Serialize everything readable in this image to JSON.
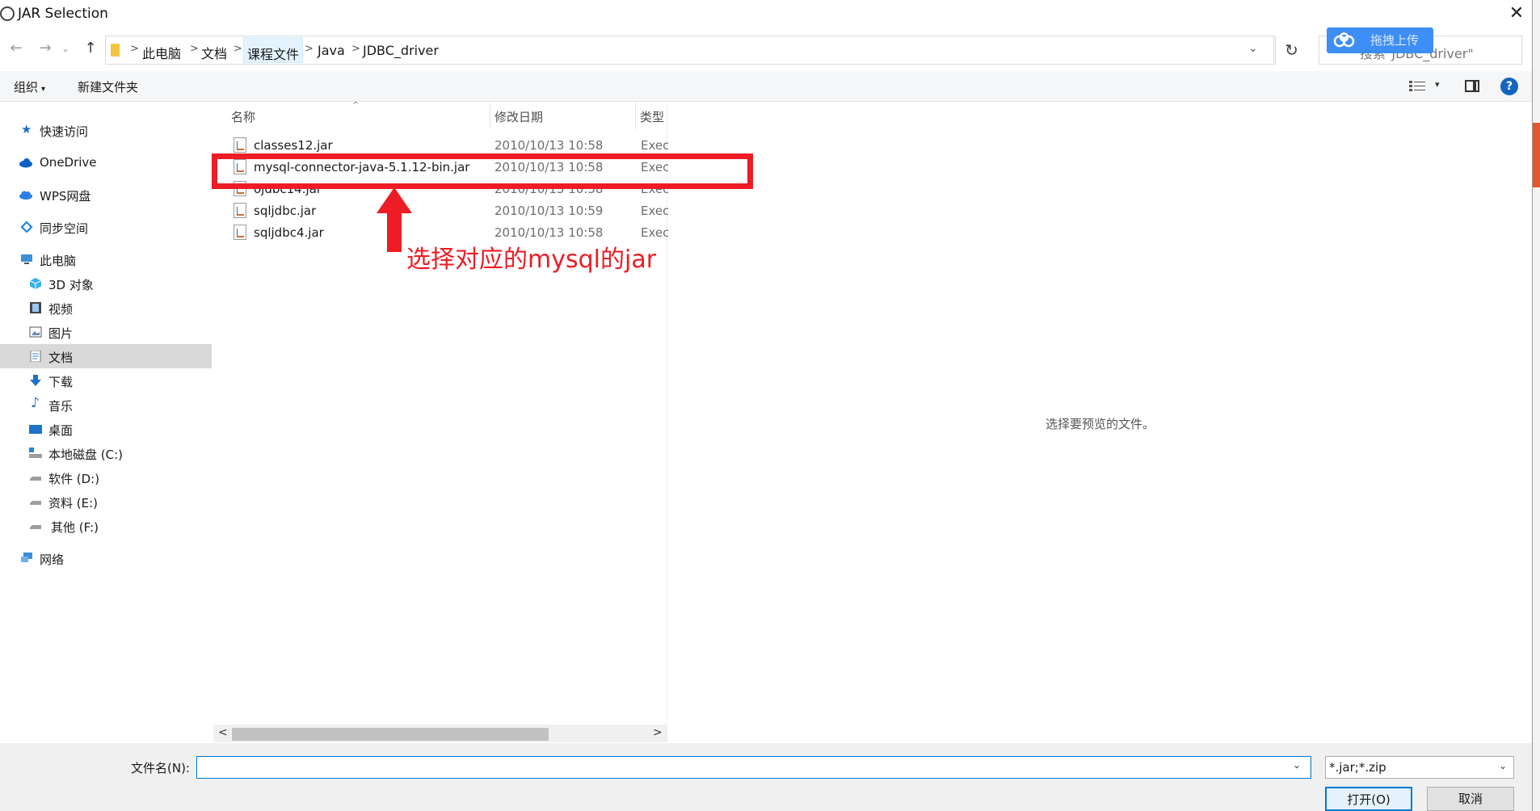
{
  "window": {
    "title": "JAR Selection"
  },
  "nav": {
    "back": "←",
    "forward": "→",
    "recent": "⌄",
    "up": "↑",
    "breadcrumb": [
      "此电脑",
      "文档",
      "课程文件",
      "Java",
      "JDBC_driver"
    ],
    "breadcrumb_sep": ">",
    "dropdown": "⌄",
    "refresh": "↻",
    "search_placeholder": "搜索\"JDBC_driver\""
  },
  "baidu_badge": {
    "label": "拖拽上传"
  },
  "toolbar": {
    "organize": "组织",
    "organize_caret": "▾",
    "new_folder": "新建文件夹",
    "view_caret": "▾",
    "help": "?"
  },
  "sidebar": {
    "items": [
      {
        "label": "快速访问",
        "icon": "star-icon"
      },
      {
        "label": "OneDrive",
        "icon": "cloud-icon"
      },
      {
        "label": "WPS网盘",
        "icon": "cloud-icon"
      },
      {
        "label": "同步空间",
        "icon": "sync-icon"
      },
      {
        "label": "此电脑",
        "icon": "computer-icon"
      },
      {
        "label": "3D 对象",
        "icon": "cube-icon"
      },
      {
        "label": "视频",
        "icon": "video-icon"
      },
      {
        "label": "图片",
        "icon": "picture-icon"
      },
      {
        "label": "文档",
        "icon": "document-icon",
        "selected": true
      },
      {
        "label": "下载",
        "icon": "download-icon"
      },
      {
        "label": "音乐",
        "icon": "music-icon"
      },
      {
        "label": "桌面",
        "icon": "desktop-icon"
      },
      {
        "label": "本地磁盘 (C:)",
        "icon": "drive-icon"
      },
      {
        "label": "软件 (D:)",
        "icon": "drive-icon"
      },
      {
        "label": "资料 (E:)",
        "icon": "drive-icon"
      },
      {
        "label": "其他 (F:)",
        "icon": "drive-icon"
      },
      {
        "label": "网络",
        "icon": "network-icon"
      }
    ]
  },
  "filelist": {
    "columns": {
      "name": "名称",
      "modified": "修改日期",
      "type": "类型"
    },
    "sort_indicator": "^",
    "files": [
      {
        "name": "classes12.jar",
        "modified": "2010/10/13 10:58",
        "type": "Exec"
      },
      {
        "name": "mysql-connector-java-5.1.12-bin.jar",
        "modified": "2010/10/13 10:58",
        "type": "Exec"
      },
      {
        "name": "ojdbc14.jar",
        "modified": "2010/10/13 10:58",
        "type": "Exec"
      },
      {
        "name": "sqljdbc.jar",
        "modified": "2010/10/13 10:59",
        "type": "Exec"
      },
      {
        "name": "sqljdbc4.jar",
        "modified": "2010/10/13 10:58",
        "type": "Exec"
      }
    ],
    "scroll_left": "<",
    "scroll_right": ">"
  },
  "preview": {
    "empty_text": "选择要预览的文件。"
  },
  "annotation": {
    "text": "选择对应的mysql的jar",
    "color": "#ee1c24"
  },
  "bottom": {
    "filename_label": "文件名(N):",
    "filename_value": "",
    "filename_caret": "⌄",
    "filter": "*.jar;*.zip",
    "filter_caret": "⌄",
    "open_button": "打开(O)",
    "cancel_button": "取消"
  },
  "colors": {
    "accent": "#0078d7",
    "selection": "#d9d9d9",
    "annotation": "#ee1c24"
  }
}
